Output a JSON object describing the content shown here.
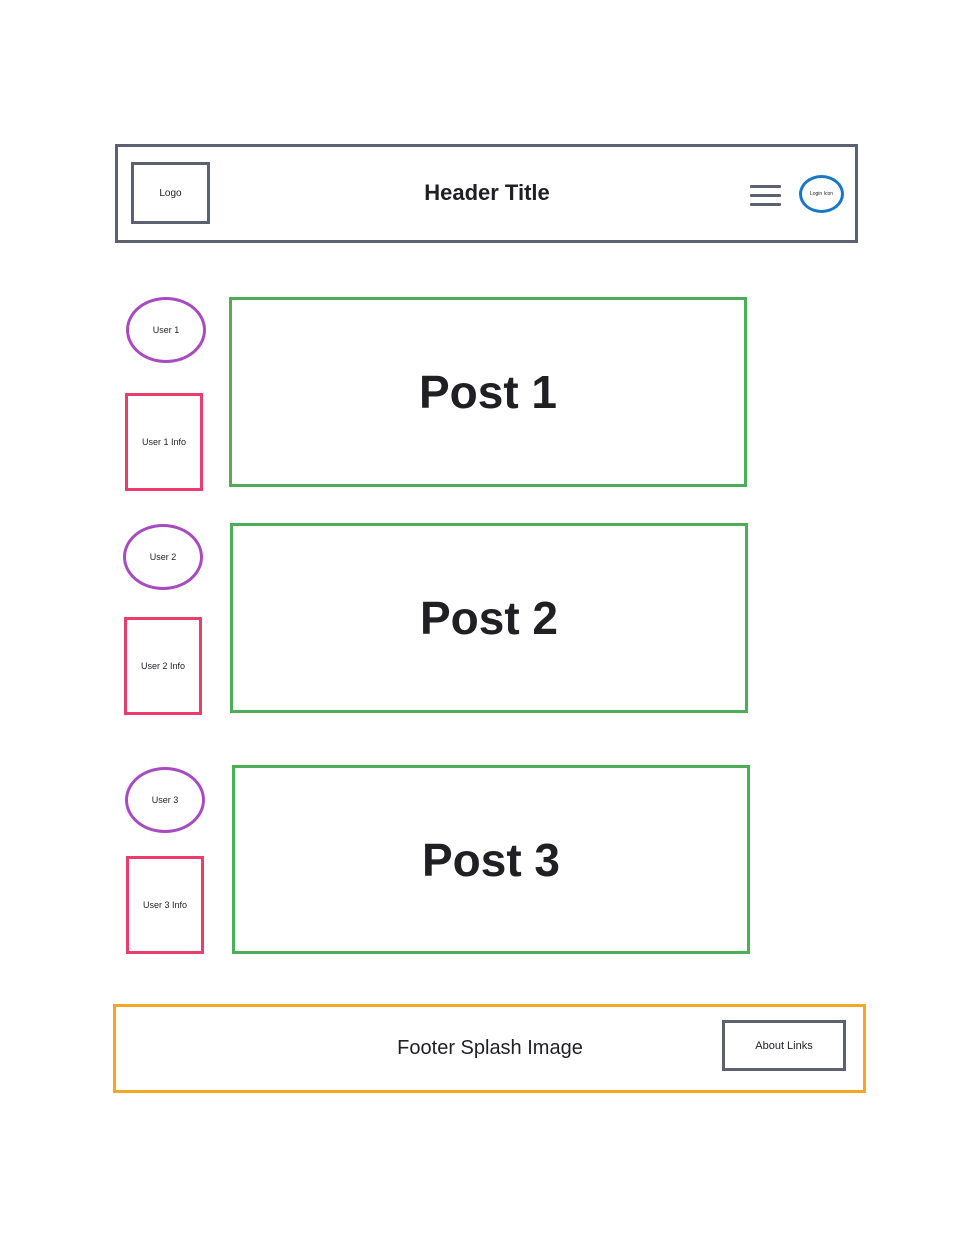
{
  "header": {
    "logo_label": "Logo",
    "title": "Header Title",
    "menu_icon": "hamburger-menu-icon",
    "login_label": "Login Icon"
  },
  "posts": [
    {
      "user_label": "User 1",
      "user_info_label": "User 1 Info",
      "post_label": "Post 1"
    },
    {
      "user_label": "User 2",
      "user_info_label": "User 2 Info",
      "post_label": "Post 2"
    },
    {
      "user_label": "User 3",
      "user_info_label": "User 3 Info",
      "post_label": "Post 3"
    }
  ],
  "footer": {
    "splash_label": "Footer Splash Image",
    "about_label": "About Links"
  },
  "colors": {
    "header_border": "#5b6170",
    "login_border": "#1877c9",
    "avatar_border": "#a84bc1",
    "info_border": "#ea3d6c",
    "post_border": "#4daf55",
    "footer_border": "#f5a623"
  }
}
